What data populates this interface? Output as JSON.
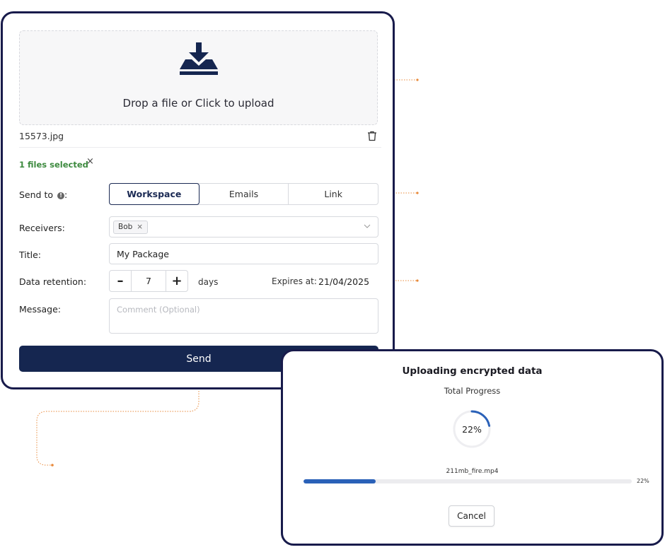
{
  "upload_form": {
    "dropzone": {
      "text": "Drop a file or Click to upload",
      "icon": "download-tray-icon"
    },
    "file": {
      "name": "15573.jpg",
      "delete_icon": "trash-icon"
    },
    "selection": {
      "text": "1 files selected",
      "clear": "×"
    },
    "send_to": {
      "label": "Send to",
      "colon": ":",
      "info_icon": "info-icon",
      "options": [
        {
          "label": "Workspace",
          "active": true
        },
        {
          "label": "Emails",
          "active": false
        },
        {
          "label": "Link",
          "active": false
        }
      ]
    },
    "receivers": {
      "label": "Receivers:",
      "chips": [
        {
          "label": "Bob",
          "remove": "×"
        }
      ]
    },
    "title": {
      "label": "Title:",
      "value": "My Package"
    },
    "retention": {
      "label": "Data retention:",
      "decrement": "–",
      "value": "7",
      "increment": "+",
      "unit": "days",
      "expires_label": "Expires at:",
      "expires_value": "21/04/2025"
    },
    "message": {
      "label": "Message:",
      "placeholder": "Comment (Optional)"
    },
    "send_button": "Send"
  },
  "progress_modal": {
    "title": "Uploading encrypted data",
    "subtitle": "Total Progress",
    "total_percent": 22,
    "total_label": "22%",
    "file_name": "211mb_fire.mp4",
    "file_percent": 22,
    "file_label": "22%",
    "cancel_button": "Cancel"
  },
  "colors": {
    "brand_navy": "#152650",
    "frame_border": "#181b4b",
    "selected_green": "#3d8a3f",
    "progress_blue": "#2a61b8",
    "annotation_orange": "#e8893a"
  }
}
